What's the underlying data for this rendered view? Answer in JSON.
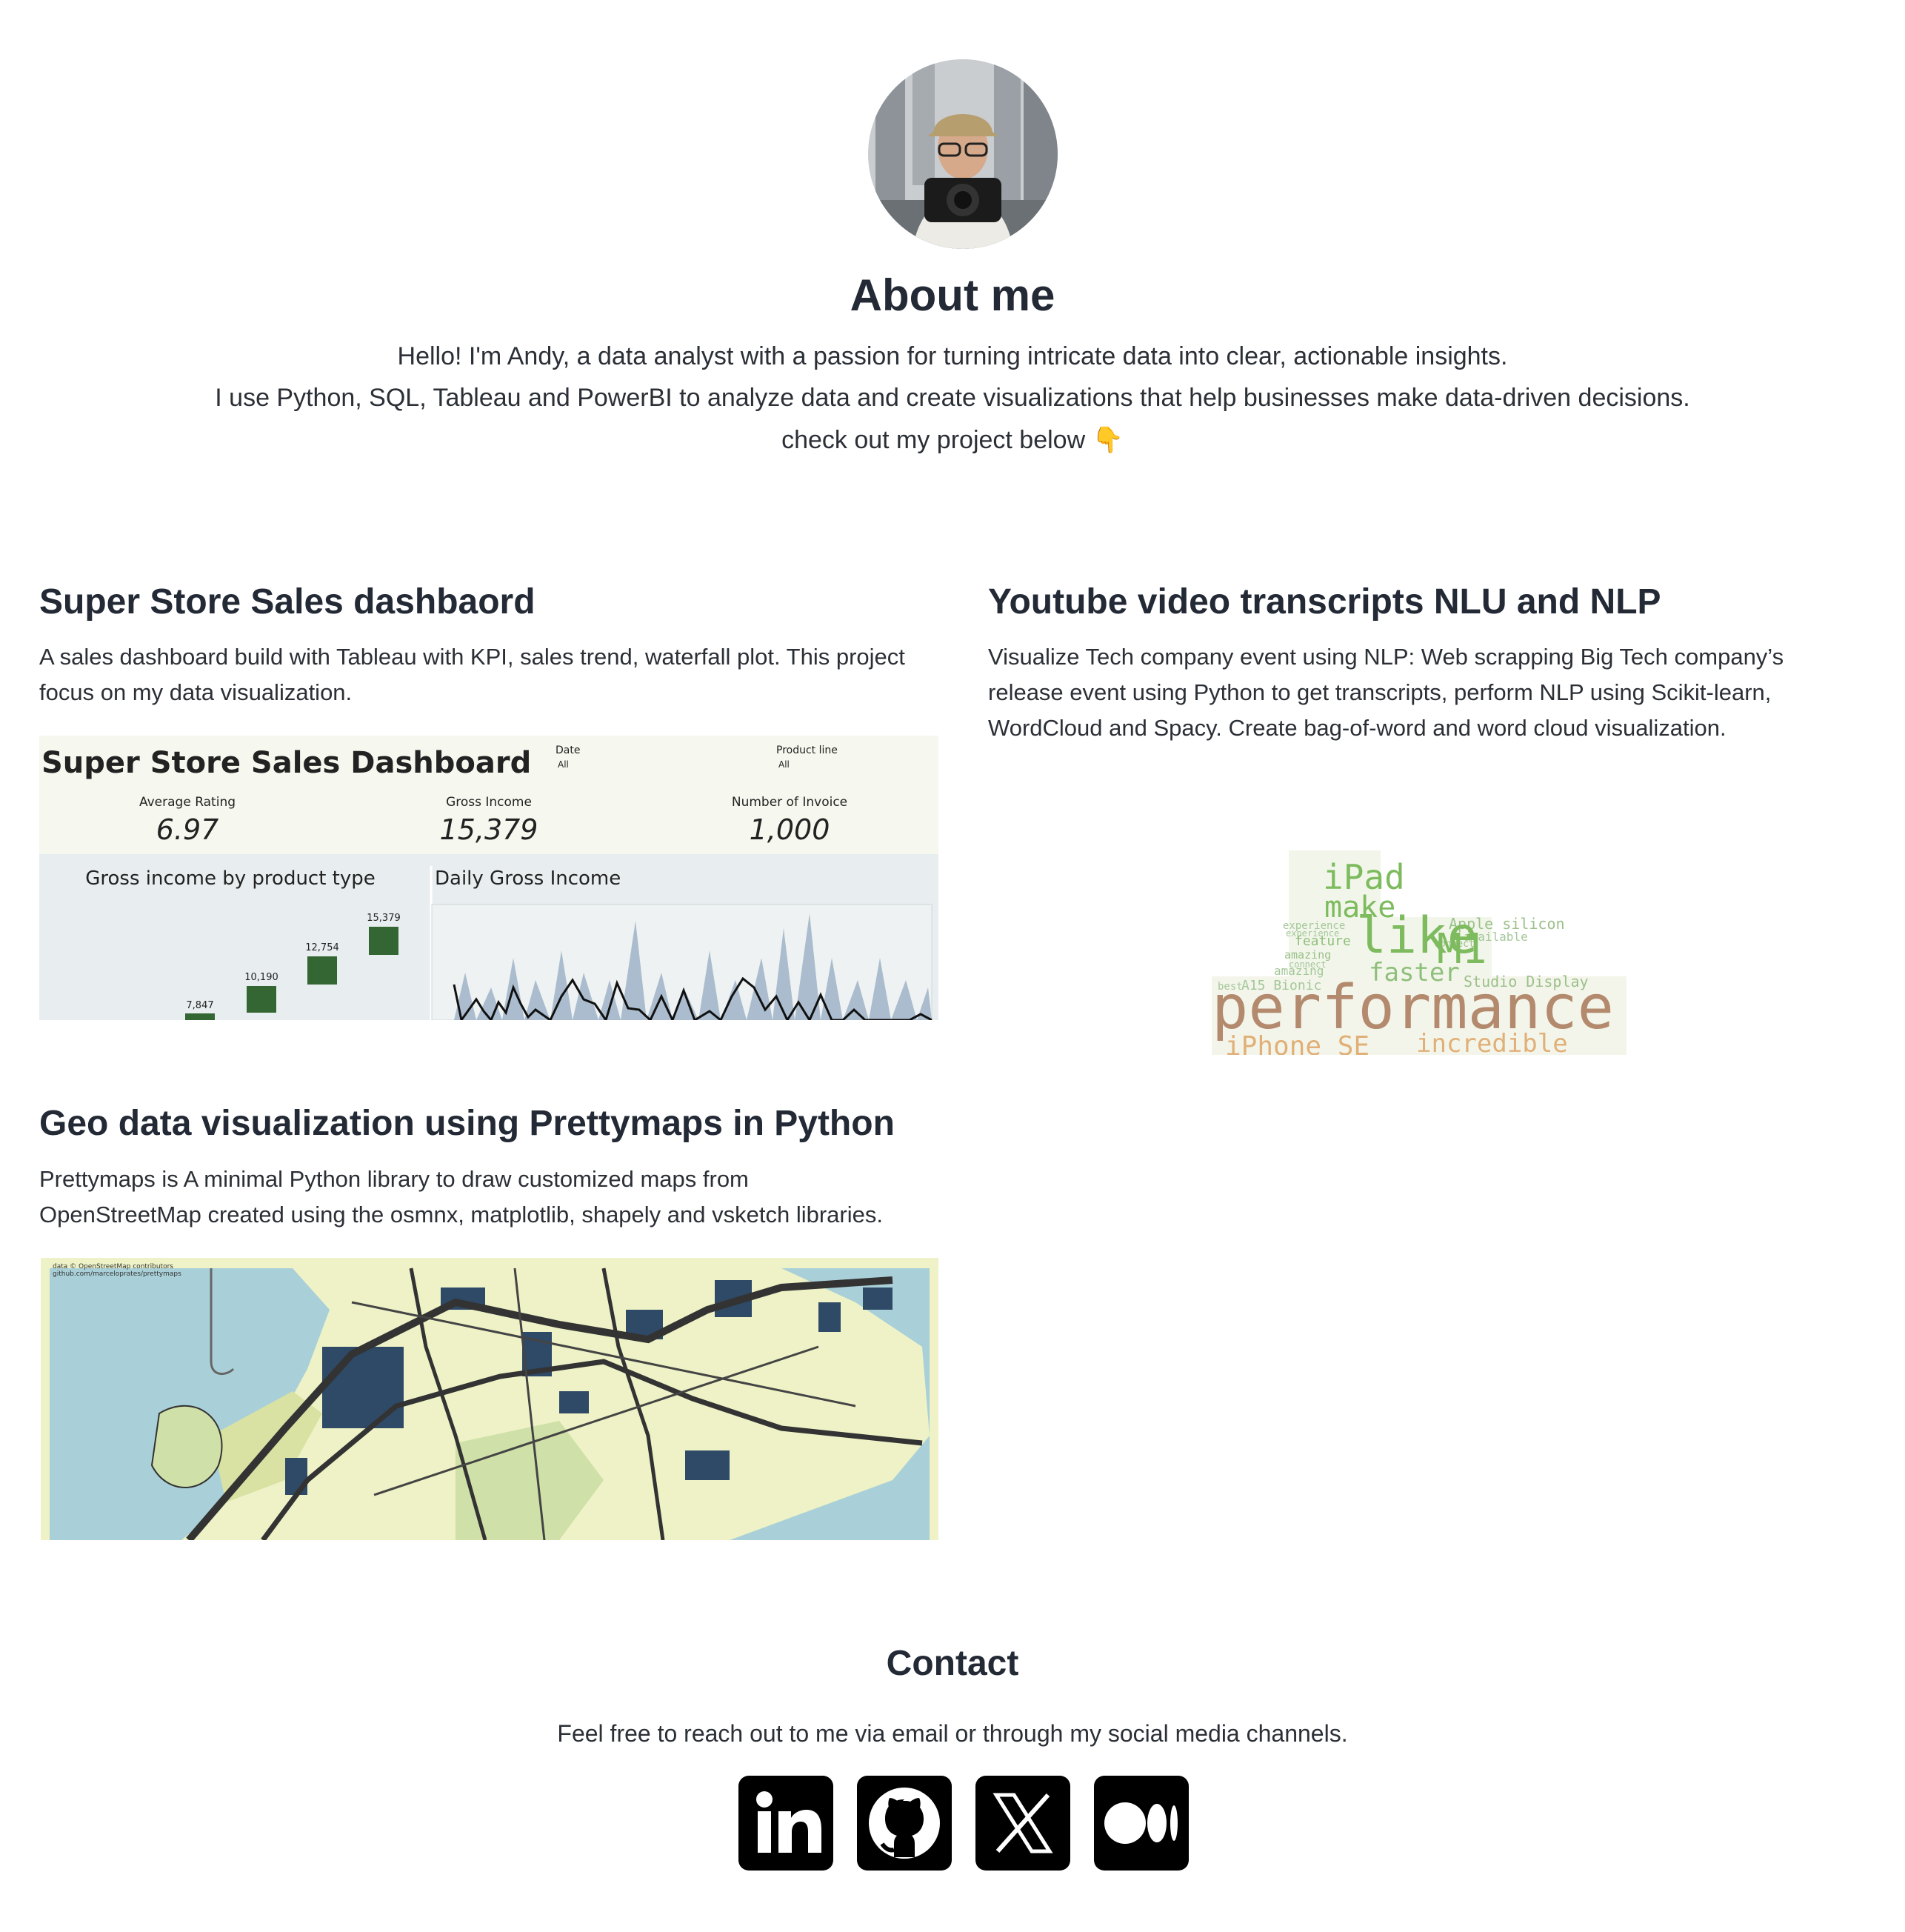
{
  "about": {
    "title": "About me",
    "line1": "Hello! I'm Andy, a data analyst with a passion for turning intricate data into clear, actionable insights.",
    "line2": "I use Python, SQL, Tableau and PowerBI to analyze data and create visualizations that help businesses make data-driven decisions.",
    "line3": "check out my project below 👇"
  },
  "projects": [
    {
      "title": "Super Store Sales dashbaord",
      "desc1": "A sales dashboard build with Tableau with KPI, sales trend, waterfall plot. This project",
      "desc2": "focus on my data visualization.",
      "dashboard": {
        "title": "Super Store Sales Dashboard",
        "filter_date_label": "Date",
        "filter_date_value": "All",
        "filter_product_label": "Product line",
        "filter_product_value": "All",
        "kpis": [
          {
            "label": "Average Rating",
            "value": "6.97"
          },
          {
            "label": "Gross Income",
            "value": "15,379"
          },
          {
            "label": "Number of Invoice",
            "value": "1,000"
          }
        ],
        "chart1_title": "Gross income by product type",
        "chart1_labels": [
          "7,847",
          "10,190",
          "12,754",
          "15,379"
        ],
        "chart2_title": "Daily Gross Income"
      }
    },
    {
      "title": "Youtube video transcripts NLU and NLP",
      "desc1": "Visualize Tech company event using NLP: Web scrapping Big Tech company’s",
      "desc2": "release event using Python to get transcripts, perform NLP using Scikit-learn,",
      "desc3": "WordCloud and Spacy. Create bag-of-word and word cloud visualization.",
      "words": [
        "iPad",
        "make",
        "Apple silicon",
        "available",
        "like",
        "M1",
        "faster",
        "performance",
        "iPhone SE",
        "incredible",
        "Studio Display",
        "A15 Bionic",
        "feature",
        "amazing",
        "experience",
        "connect",
        "best"
      ]
    },
    {
      "title": "Geo data visualization using Prettymaps in Python",
      "desc1": "Prettymaps is A minimal Python library to draw customized maps from",
      "desc2": "OpenStreetMap created using the osmnx, matplotlib, shapely and vsketch libraries.",
      "map_credit1": "data © OpenStreetMap contributors",
      "map_credit2": "github.com/marceloprates/prettymaps"
    }
  ],
  "contact": {
    "title": "Contact",
    "text": "Feel free to reach out to me via email or through my social media channels.",
    "socials": [
      "linkedin-icon",
      "github-icon",
      "x-icon",
      "medium-icon"
    ]
  },
  "colors": {
    "dash_green": "#336633",
    "dash_bg": "#f6f7ee",
    "map_water": "#a9d0d8",
    "map_land": "#eef2c6",
    "map_building": "#2f4a66"
  }
}
